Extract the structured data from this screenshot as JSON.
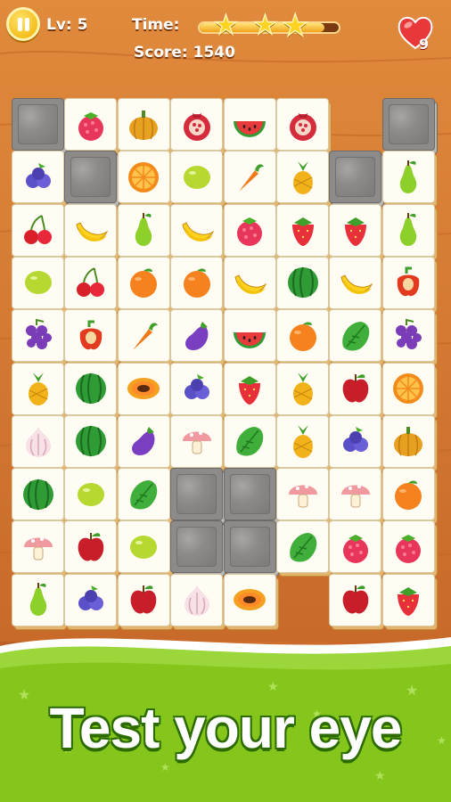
{
  "hud": {
    "level_label": "Lv: 5",
    "time_label": "Time:",
    "score_label": "Score: 1540",
    "time_progress": 0.9,
    "stars_earned": 3,
    "lives_count": "9"
  },
  "tagline": "Test your eye",
  "colors": {
    "wood": "#d9772f",
    "tile_face": "#fffdf3",
    "tile_edge": "#e2b46e",
    "stone": "#8d8a8a",
    "grass": "#8fce1f",
    "text_outline": "#2b6b00"
  },
  "board": {
    "rows": [
      [
        "stone",
        "raspberry",
        "pumpkin",
        "pomegranate",
        "watermelon-slice",
        "pomegranate",
        null,
        "stone"
      ],
      [
        "blueberries",
        "stone",
        "orange-half",
        "lime",
        "carrot",
        "pineapple",
        "stone",
        "pear"
      ],
      [
        "cherries",
        "banana",
        "pear",
        "banana",
        "raspberry",
        "strawberry",
        "strawberry",
        "pear"
      ],
      [
        "lime",
        "cherries",
        "tangerine",
        "tangerine",
        "banana",
        "watermelon",
        "banana",
        "bell-pepper"
      ],
      [
        "grapes",
        "bell-pepper",
        "carrot",
        "eggplant",
        "watermelon-slice",
        "tangerine",
        "lettuce",
        "grapes"
      ],
      [
        "pineapple",
        "watermelon",
        "papaya",
        "blueberries",
        "strawberry",
        "pineapple",
        "apple",
        "orange-half"
      ],
      [
        "garlic",
        "watermelon",
        "eggplant",
        "mushroom",
        "lettuce",
        "pineapple",
        "blueberries",
        "pumpkin"
      ],
      [
        "watermelon",
        "lime",
        "lettuce",
        "stone",
        "stone",
        "mushroom",
        "mushroom",
        "tangerine"
      ],
      [
        "mushroom",
        "apple",
        "lime",
        "stone",
        "stone",
        "lettuce",
        "raspberry",
        "raspberry"
      ],
      [
        "pear",
        "blueberries",
        "apple",
        "garlic",
        "papaya",
        null,
        "apple",
        "strawberry"
      ]
    ]
  }
}
